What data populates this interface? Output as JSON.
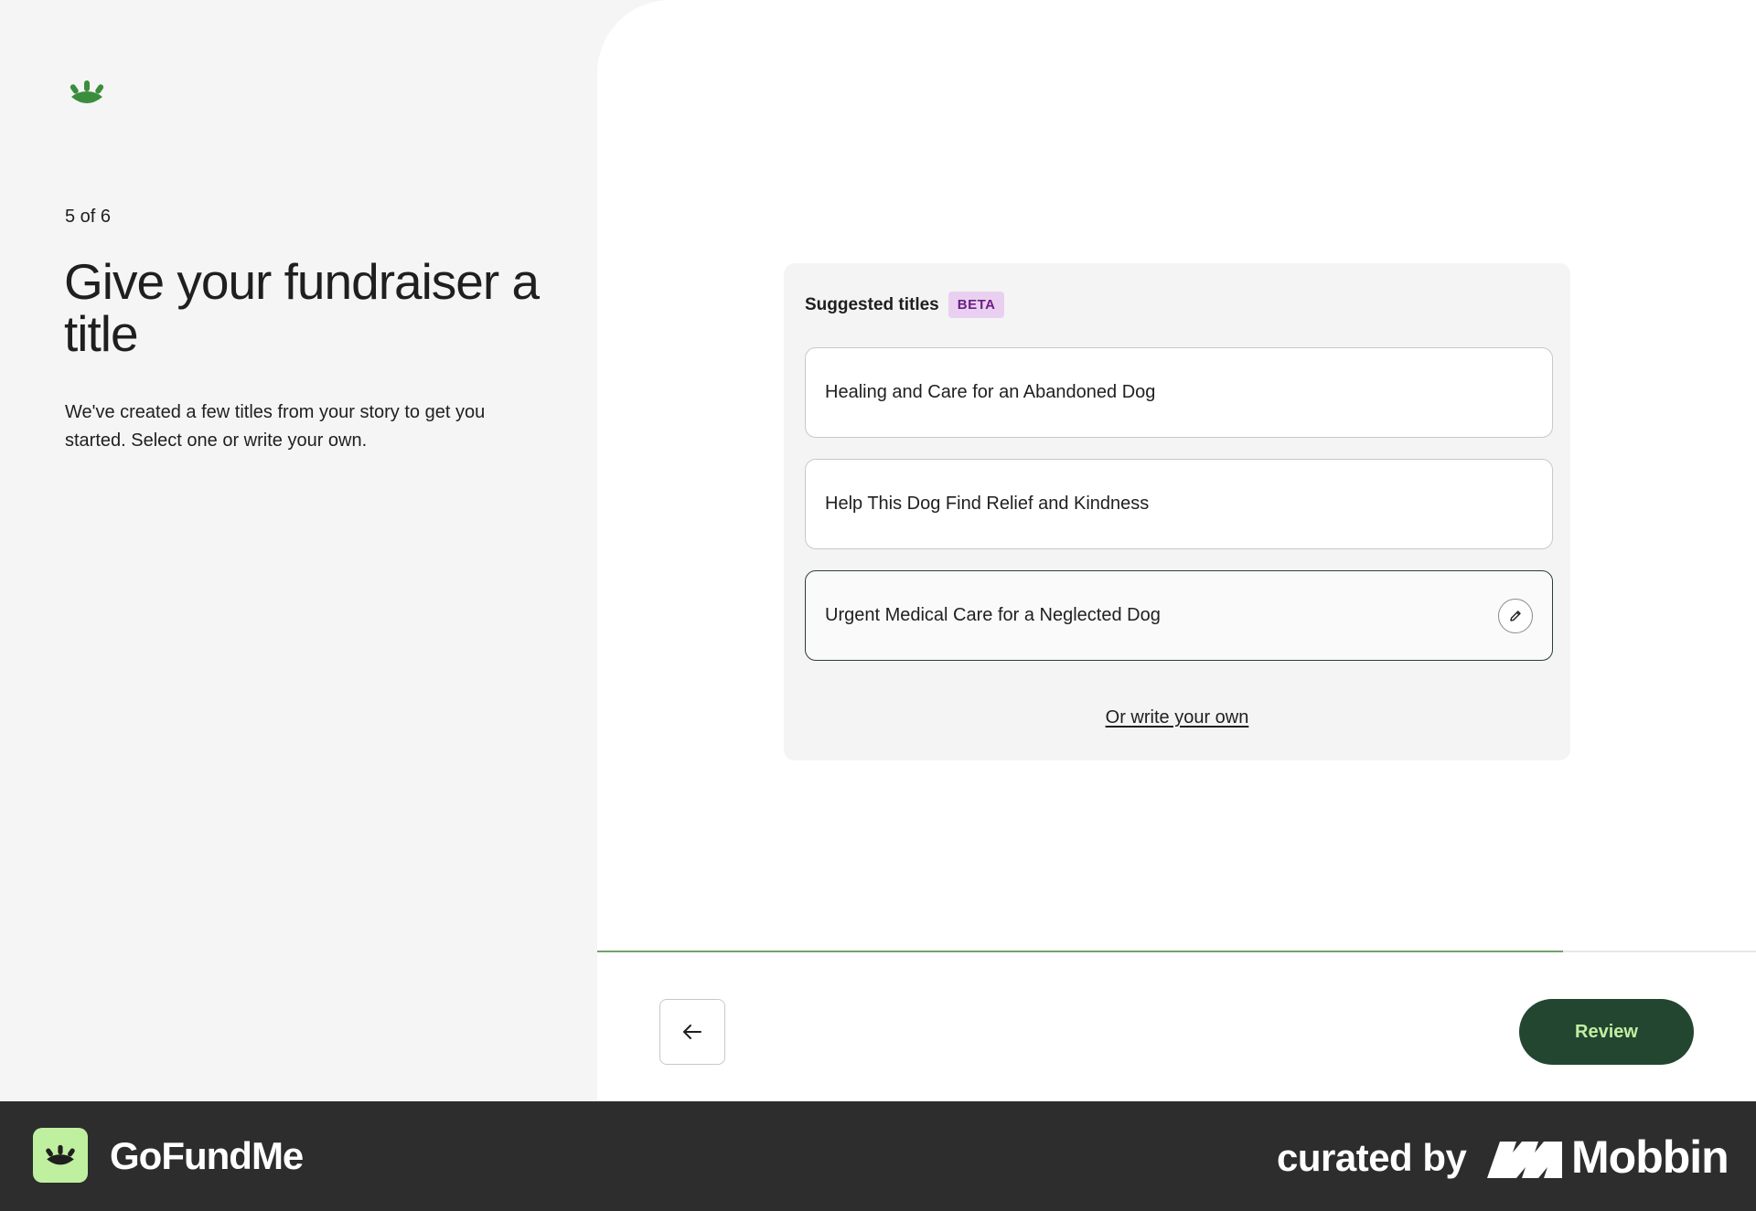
{
  "left": {
    "step": "5 of 6",
    "heading": "Give your fundraiser a title",
    "description": "We've created a few titles from your story to get you started. Select one or write your own."
  },
  "card": {
    "title": "Suggested titles",
    "badge": "BETA",
    "options": [
      {
        "label": "Healing and Care for an Abandoned Dog",
        "selected": false
      },
      {
        "label": "Help This Dog Find Relief and Kindness",
        "selected": false
      },
      {
        "label": "Urgent Medical Care for a Neglected Dog",
        "selected": true
      }
    ],
    "write_own": "Or write your own"
  },
  "progress": {
    "fraction": 0.8333
  },
  "nav": {
    "back_icon": "arrow-left-icon",
    "review_label": "Review"
  },
  "footer": {
    "brand": "GoFundMe",
    "curated_by": "curated by",
    "mobbin": "Mobbin"
  },
  "colors": {
    "accent_green": "#3a8d3c",
    "dark_green": "#234631",
    "light_green": "#bff0a0",
    "beta_bg": "#ead0f0",
    "beta_text": "#6b1f86",
    "footer_bg": "#2d2d2d"
  }
}
